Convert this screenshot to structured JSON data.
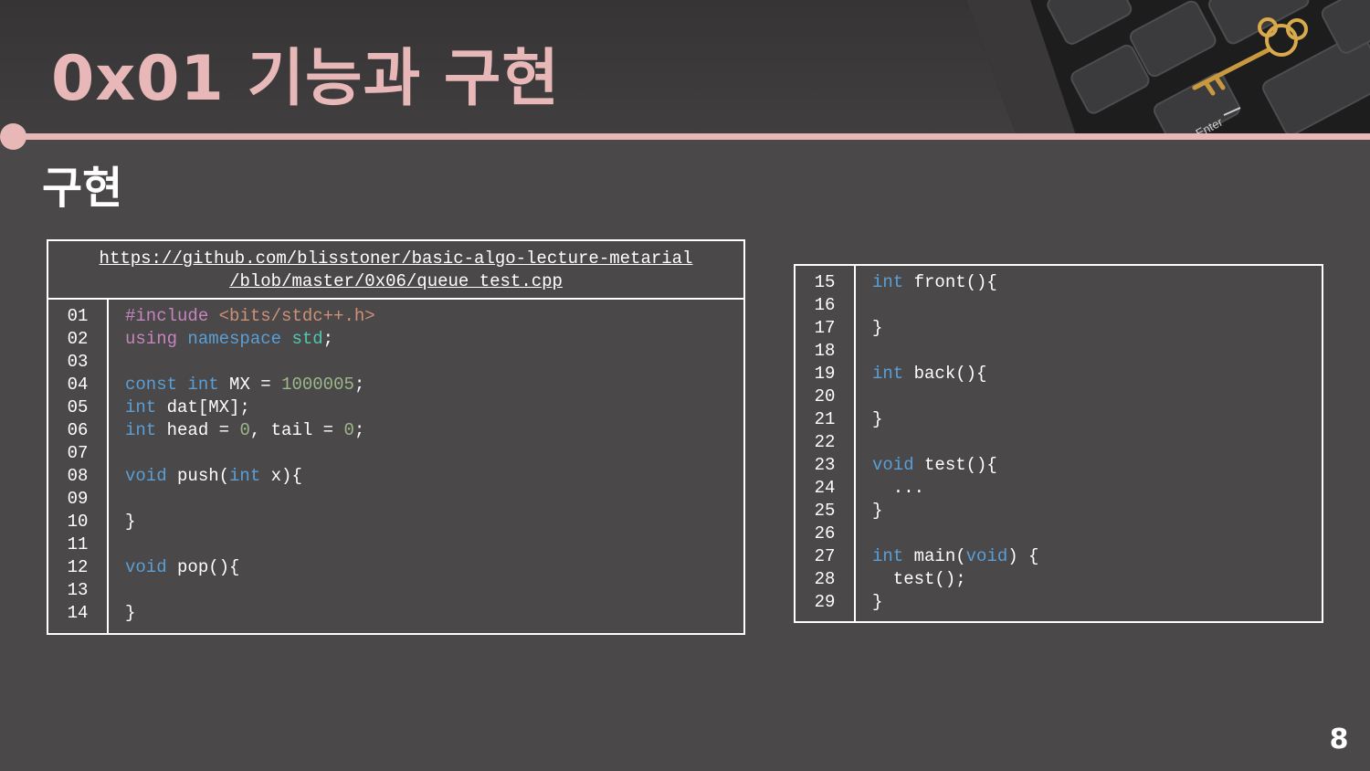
{
  "slide": {
    "title": "0x01  기능과 구현",
    "subtitle": "구현",
    "page_number": "8"
  },
  "header_image": {
    "key_label": "Enter",
    "icon": "key-on-keyboard-icon"
  },
  "code_left": {
    "url_line1": "https://github.com/blisstoner/basic-algo-lecture-metarial",
    "url_line2": "/blob/master/0x06/queue_test.cpp",
    "line_numbers": [
      "01",
      "02",
      "03",
      "04",
      "05",
      "06",
      "07",
      "08",
      "09",
      "10",
      "11",
      "12",
      "13",
      "14"
    ]
  },
  "code_right": {
    "line_numbers": [
      "15",
      "16",
      "17",
      "18",
      "19",
      "20",
      "21",
      "22",
      "23",
      "24",
      "25",
      "26",
      "27",
      "28",
      "29"
    ]
  },
  "colors": {
    "accent": "#e8b8b8",
    "background": "#4a4849",
    "keyword": "#5a9fd6",
    "directive": "#c586c0",
    "string": "#ce9178",
    "number": "#9cb88a",
    "namespace": "#4ec9b0"
  }
}
